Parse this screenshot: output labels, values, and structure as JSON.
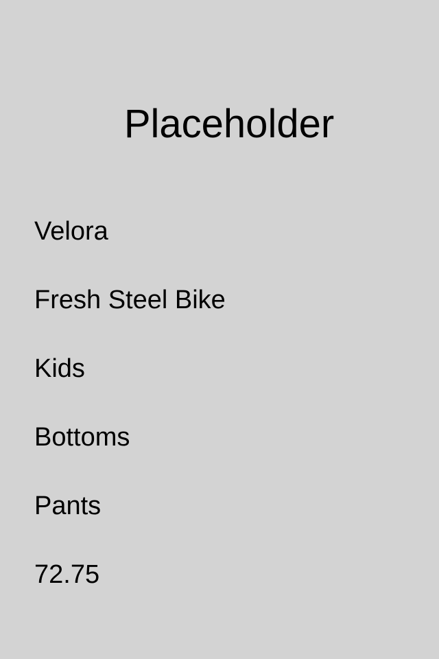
{
  "page": {
    "title": "Placeholder"
  },
  "product": {
    "brand": "Velora",
    "name": "Fresh Steel Bike",
    "audience": "Kids",
    "category": "Bottoms",
    "subcategory": "Pants",
    "price": "72.75"
  },
  "colors": {
    "background": "#d3d3d3",
    "text": "#000000"
  }
}
